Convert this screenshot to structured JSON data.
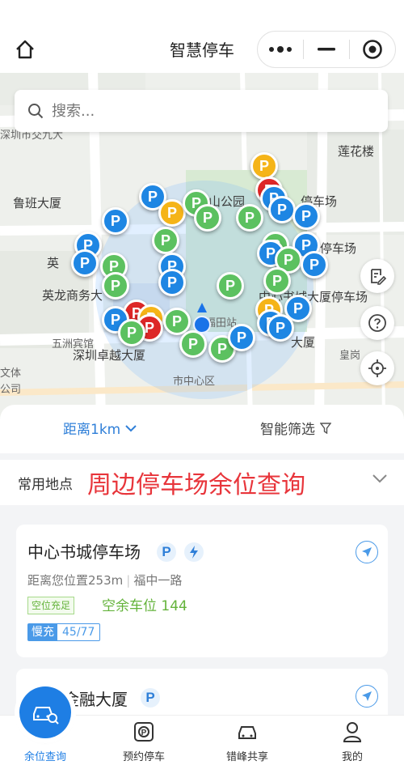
{
  "header": {
    "title": "智慧停车"
  },
  "search": {
    "placeholder": "搜索..."
  },
  "map": {
    "labels": [
      {
        "id": "luban",
        "text": "鲁班大厦"
      },
      {
        "id": "lianhua",
        "text": "莲花楼"
      },
      {
        "id": "shenzhen_bay",
        "text": "深圳市交九大"
      },
      {
        "id": "yinglong",
        "text": "英龙商务大"
      },
      {
        "id": "ying",
        "text": "英"
      },
      {
        "id": "wuzhou",
        "text": "五洲宾馆"
      },
      {
        "id": "zhuoyue",
        "text": "深圳卓越大厦"
      },
      {
        "id": "center_district",
        "text": "市中心区"
      },
      {
        "id": "futian_station",
        "text": "福田站"
      },
      {
        "id": "wenhua",
        "text": "文体"
      },
      {
        "id": "gongsi",
        "text": "公司"
      },
      {
        "id": "huangting",
        "text": "皇岗"
      },
      {
        "id": "parking_lot_a",
        "text": "停车场"
      },
      {
        "id": "parking_lot_b",
        "text": "停车场"
      },
      {
        "id": "zhongxin_lot",
        "text": "中心书城大厦停车场"
      },
      {
        "id": "dasha",
        "text": "大厦"
      },
      {
        "id": "park",
        "text": "山公园"
      }
    ]
  },
  "filters": {
    "distance": "距离1km",
    "smart": "智能筛选"
  },
  "common": {
    "label": "常用地点",
    "banner": "周边停车场余位查询"
  },
  "cards": [
    {
      "name": "中心书城停车场",
      "distance": "距离您位置253m",
      "address": "福中一路",
      "tag": "空位充足",
      "spaces": "空余车位 144",
      "slow_label": "慢充",
      "slow_value": "45/77"
    },
    {
      "name": "金融大厦"
    }
  ],
  "tabs": [
    {
      "label": "余位查询"
    },
    {
      "label": "预约停车"
    },
    {
      "label": "错峰共享"
    },
    {
      "label": "我的"
    }
  ],
  "colors": {
    "accent": "#1e7ee4",
    "banner": "#e8353b",
    "green": "#64b33b"
  }
}
